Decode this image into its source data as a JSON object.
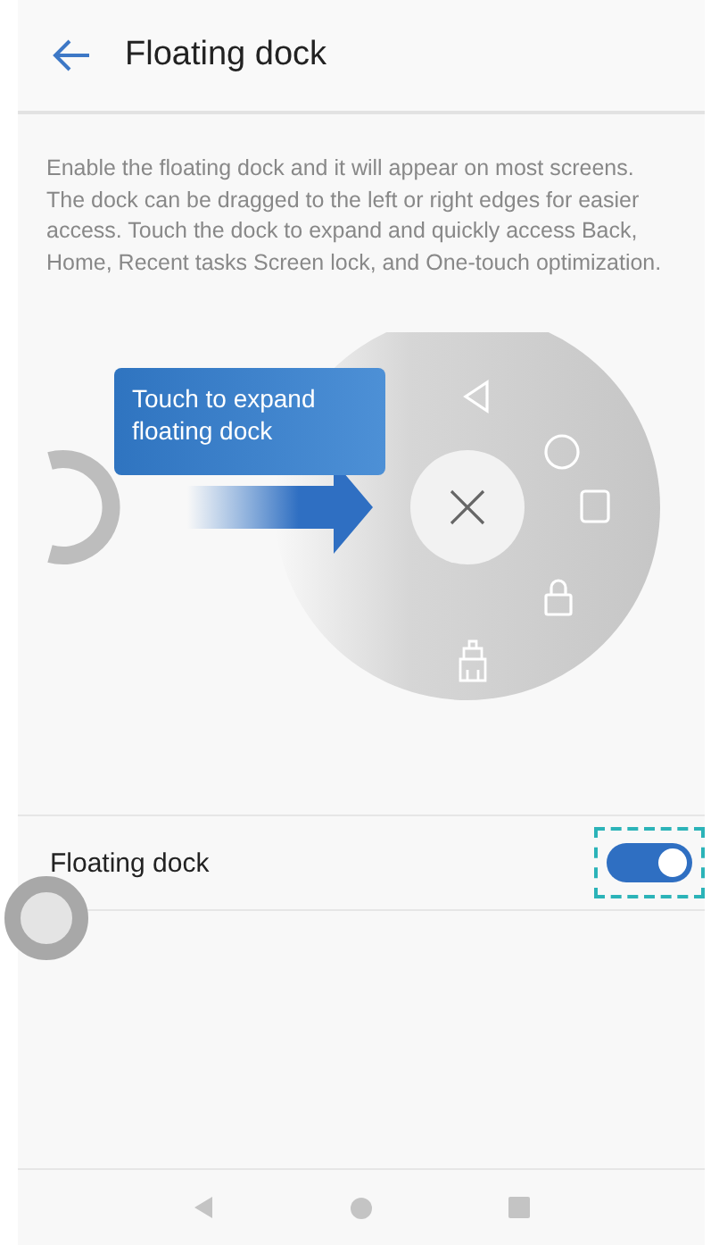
{
  "header": {
    "title": "Floating dock"
  },
  "description": "Enable the floating dock and it will appear on most screens. The dock can be dragged to the left or right edges for easier access. Touch the dock to expand and quickly access Back, Home, Recent tasks Screen lock, and One-touch optimization.",
  "illustration": {
    "callout": "Touch to expand floating dock"
  },
  "settings": [
    {
      "label": "Floating dock",
      "on": true,
      "highlighted": true
    }
  ]
}
